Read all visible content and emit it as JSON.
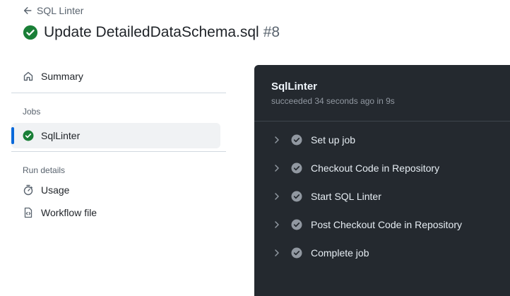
{
  "breadcrumb": {
    "back_label": "SQL Linter"
  },
  "run": {
    "title": "Update DetailedDataSchema.sql",
    "number": "#8"
  },
  "sidebar": {
    "summary_label": "Summary",
    "jobs_heading": "Jobs",
    "job_label": "SqlLinter",
    "run_details_heading": "Run details",
    "usage_label": "Usage",
    "workflow_label": "Workflow file"
  },
  "job": {
    "title": "SqlLinter",
    "meta": "succeeded 34 seconds ago in 9s",
    "steps": [
      {
        "label": "Set up job"
      },
      {
        "label": "Checkout Code in Repository"
      },
      {
        "label": "Start SQL Linter"
      },
      {
        "label": "Post Checkout Code in Repository"
      },
      {
        "label": "Complete job"
      }
    ]
  },
  "colors": {
    "success": "#1a7f37",
    "accent": "#0969da",
    "panel_bg": "#24292f"
  }
}
